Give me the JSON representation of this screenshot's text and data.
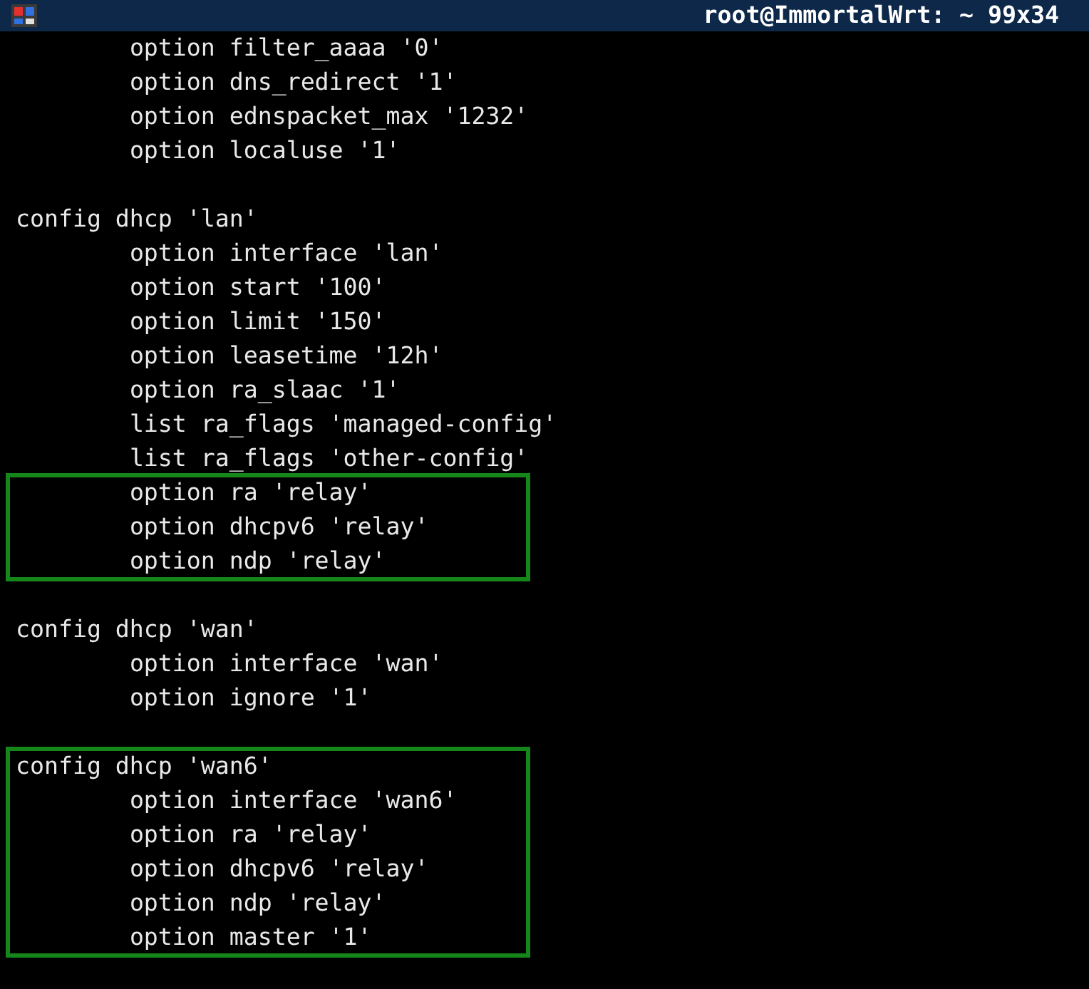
{
  "window": {
    "title": "root@ImmortalWrt: ~ 99x34"
  },
  "blocks": [
    [
      {
        "text": "\toption filter_aaaa '0'",
        "highlighted": false
      },
      {
        "text": "\toption dns_redirect '1'",
        "highlighted": false
      },
      {
        "text": "\toption ednspacket_max '1232'",
        "highlighted": false
      },
      {
        "text": "\toption localuse '1'",
        "highlighted": false
      }
    ],
    [
      {
        "text": "config dhcp 'lan'",
        "highlighted": false
      },
      {
        "text": "\toption interface 'lan'",
        "highlighted": false
      },
      {
        "text": "\toption start '100'",
        "highlighted": false
      },
      {
        "text": "\toption limit '150'",
        "highlighted": false
      },
      {
        "text": "\toption leasetime '12h'",
        "highlighted": false
      },
      {
        "text": "\toption ra_slaac '1'",
        "highlighted": false
      },
      {
        "text": "\tlist ra_flags 'managed-config'",
        "highlighted": false
      },
      {
        "text": "\tlist ra_flags 'other-config'",
        "highlighted": false
      },
      {
        "text": "\toption ra 'relay'",
        "highlighted": true
      },
      {
        "text": "\toption dhcpv6 'relay'",
        "highlighted": true
      },
      {
        "text": "\toption ndp 'relay'",
        "highlighted": true
      }
    ],
    [
      {
        "text": "config dhcp 'wan'",
        "highlighted": false
      },
      {
        "text": "\toption interface 'wan'",
        "highlighted": false
      },
      {
        "text": "\toption ignore '1'",
        "highlighted": false
      }
    ],
    [
      {
        "text": "config dhcp 'wan6'",
        "highlighted": true
      },
      {
        "text": "\toption interface 'wan6'",
        "highlighted": true
      },
      {
        "text": "\toption ra 'relay'",
        "highlighted": true
      },
      {
        "text": "\toption dhcpv6 'relay'",
        "highlighted": true
      },
      {
        "text": "\toption ndp 'relay'",
        "highlighted": true
      },
      {
        "text": "\toption master '1'",
        "highlighted": true
      }
    ]
  ]
}
